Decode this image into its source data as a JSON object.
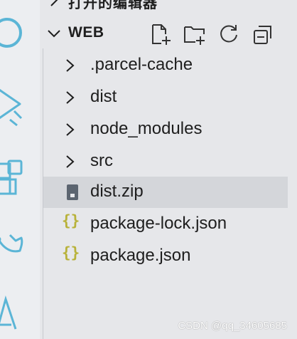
{
  "open_editors": {
    "label": "打开的编辑器"
  },
  "workspace": {
    "title": "WEB"
  },
  "header_actions": [
    "new-file-icon",
    "new-folder-icon",
    "refresh-icon",
    "collapse-all-icon"
  ],
  "tree": [
    {
      "name": ".parcel-cache",
      "type": "folder"
    },
    {
      "name": "dist",
      "type": "folder"
    },
    {
      "name": "node_modules",
      "type": "folder"
    },
    {
      "name": "src",
      "type": "folder"
    },
    {
      "name": "dist.zip",
      "type": "file-zip",
      "selected": true
    },
    {
      "name": "package-lock.json",
      "type": "file-json"
    },
    {
      "name": "package.json",
      "type": "file-json"
    }
  ],
  "watermark": "CSDN @qq_34605685",
  "colors": {
    "activity_icon": "#5bb5d6",
    "json_icon": "#b8b23a",
    "zip_icon": "#5c6570"
  }
}
